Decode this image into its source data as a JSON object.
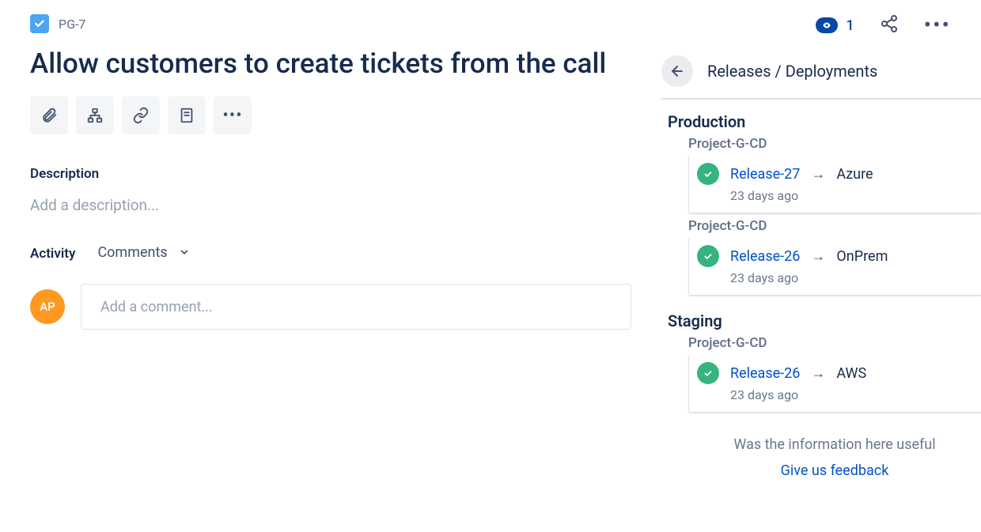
{
  "breadcrumb": {
    "key": "PG-7"
  },
  "title": "Allow customers to create tickets from the call",
  "description": {
    "label": "Description",
    "placeholder": "Add a description..."
  },
  "activity": {
    "label": "Activity",
    "filter": "Comments"
  },
  "comment": {
    "avatar_initials": "AP",
    "placeholder": "Add a comment..."
  },
  "watch": {
    "count": "1"
  },
  "side": {
    "title": "Releases / Deployments",
    "feedback_question": "Was the information here useful",
    "feedback_link": "Give us feedback",
    "environments": [
      {
        "name": "Production",
        "groups": [
          {
            "pipeline": "Project-G-CD",
            "release": "Release-27",
            "target": "Azure",
            "time": "23 days ago"
          },
          {
            "pipeline": "Project-G-CD",
            "release": "Release-26",
            "target": "OnPrem",
            "time": "23 days ago"
          }
        ]
      },
      {
        "name": "Staging",
        "groups": [
          {
            "pipeline": "Project-G-CD",
            "release": "Release-26",
            "target": "AWS",
            "time": "23 days ago"
          }
        ]
      }
    ]
  }
}
